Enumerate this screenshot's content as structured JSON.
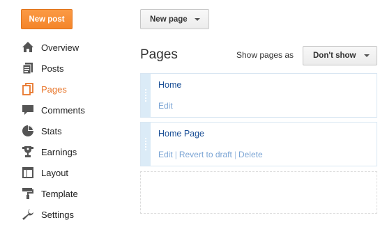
{
  "header": {
    "new_post_label": "New post",
    "new_page_label": "New page"
  },
  "sidebar": {
    "items": [
      {
        "label": "Overview",
        "icon": "home-icon",
        "active": false
      },
      {
        "label": "Posts",
        "icon": "posts-icon",
        "active": false
      },
      {
        "label": "Pages",
        "icon": "pages-icon",
        "active": true
      },
      {
        "label": "Comments",
        "icon": "comments-icon",
        "active": false
      },
      {
        "label": "Stats",
        "icon": "stats-icon",
        "active": false
      },
      {
        "label": "Earnings",
        "icon": "earnings-icon",
        "active": false
      },
      {
        "label": "Layout",
        "icon": "layout-icon",
        "active": false
      },
      {
        "label": "Template",
        "icon": "template-icon",
        "active": false
      },
      {
        "label": "Settings",
        "icon": "settings-icon",
        "active": false
      }
    ]
  },
  "main": {
    "title": "Pages",
    "show_pages_label": "Show pages as",
    "show_pages_value": "Don't show",
    "pages": [
      {
        "title": "Home",
        "actions": [
          "Edit"
        ]
      },
      {
        "title": "Home Page",
        "actions": [
          "Edit",
          "Revert to draft",
          "Delete"
        ]
      }
    ]
  },
  "colors": {
    "accent": "#f4852a",
    "active_nav": "#e8762b",
    "link": "#1a4f96",
    "action_link": "#7aa4d4",
    "handle": "#dbebf7"
  }
}
